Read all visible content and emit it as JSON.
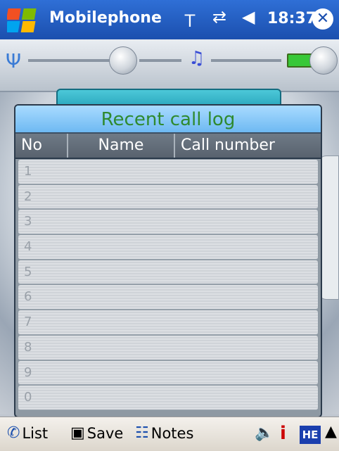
{
  "titlebar": {
    "title": "Mobilephone",
    "time": "18:37",
    "icons": [
      "windows-start-icon",
      "signal-icon",
      "connection-icon",
      "volume-icon",
      "close-icon"
    ]
  },
  "skin": {
    "icons": [
      "antenna-icon",
      "music-note-icon",
      "battery-icon"
    ]
  },
  "call_log": {
    "title": "Recent call log",
    "columns": [
      "No",
      "Name",
      "Call number"
    ],
    "rows": [
      {
        "no": "1",
        "name": "",
        "number": ""
      },
      {
        "no": "2",
        "name": "",
        "number": ""
      },
      {
        "no": "3",
        "name": "",
        "number": ""
      },
      {
        "no": "4",
        "name": "",
        "number": ""
      },
      {
        "no": "5",
        "name": "",
        "number": ""
      },
      {
        "no": "6",
        "name": "",
        "number": ""
      },
      {
        "no": "7",
        "name": "",
        "number": ""
      },
      {
        "no": "8",
        "name": "",
        "number": ""
      },
      {
        "no": "9",
        "name": "",
        "number": ""
      },
      {
        "no": "0",
        "name": "",
        "number": ""
      }
    ]
  },
  "cmdbar": {
    "list_label": "List",
    "save_label": "Save",
    "notes_label": "Notes",
    "ime_label": "HE"
  },
  "colors": {
    "titlebar": "#1b4fae",
    "panel_title_bg": "#6eb9f2",
    "panel_title_text": "#2f8a2f"
  }
}
